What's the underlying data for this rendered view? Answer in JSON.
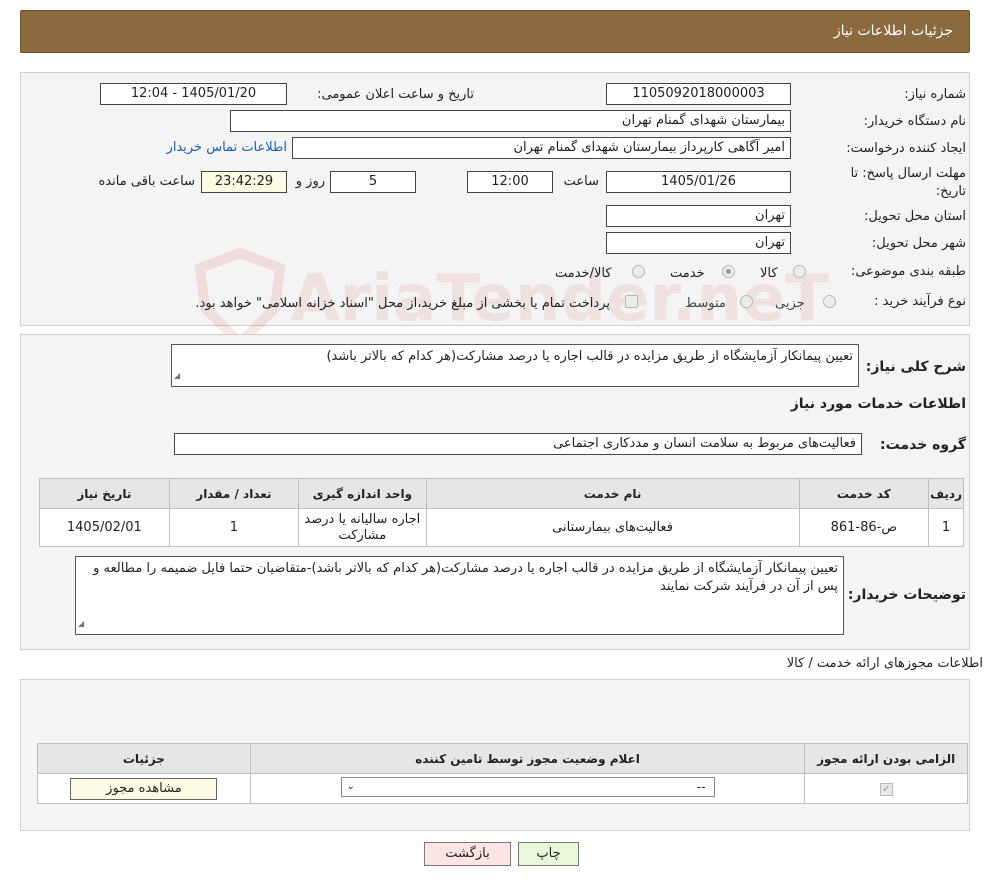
{
  "header": {
    "title": "جزئیات اطلاعات نیاز"
  },
  "form": {
    "need_number_label": "شماره نیاز:",
    "need_number": "1105092018000003",
    "announce_label": "تاریخ و ساعت اعلان عمومی:",
    "announce_value": "1405/01/20 - 12:04",
    "buyer_org_label": "نام دستگاه خریدار:",
    "buyer_org": "بیمارستان شهدای گمنام تهران",
    "creator_label": "ایجاد کننده درخواست:",
    "creator": "امیر آگاهی کارپرداز بیمارستان شهدای گمنام تهران",
    "contact_link": "اطلاعات تماس خریدار",
    "deadline_label_1": "مهلت ارسال پاسخ: تا",
    "deadline_label_2": "تاریخ:",
    "deadline_date": "1405/01/26",
    "time_label": "ساعت",
    "deadline_time": "12:00",
    "days_value": "5",
    "days_label": "روز و",
    "remaining_time": "23:42:29",
    "remaining_label": "ساعت باقی مانده",
    "province_label": "استان محل تحویل:",
    "province": "تهران",
    "city_label": "شهر محل تحویل:",
    "city": "تهران",
    "category_label": "طبقه بندی موضوعی:",
    "category_options": [
      "کالا",
      "خدمت",
      "کالا/خدمت"
    ],
    "category_selected": "خدمت",
    "process_label": "نوع فرآیند خرید :",
    "process_options": [
      "جزیی",
      "متوسط"
    ],
    "process_note": "پرداخت تمام یا بخشی از مبلغ خرید،از محل \"اسناد خزانه اسلامی\" خواهد بود."
  },
  "description": {
    "label": "شرح کلی نیاز:",
    "value": "تعیین پیمانکار آزمایشگاه از طریق مزایده در قالب اجاره یا درصد مشارکت(هر کدام که بالاتر باشد)"
  },
  "services": {
    "section_title": "اطلاعات خدمات مورد نیاز",
    "group_label": "گروه خدمت:",
    "group_value": "فعالیت‌های مربوط به سلامت انسان و مددکاری اجتماعی",
    "table": {
      "headers": [
        "ردیف",
        "کد خدمت",
        "نام خدمت",
        "واحد اندازه گیری",
        "تعداد / مقدار",
        "تاریخ نیاز"
      ],
      "rows": [
        [
          "1",
          "ص-86-861",
          "فعالیت‌های بیمارستانی",
          "اجاره سالیانه یا درصد مشارکت",
          "1",
          "1405/02/01"
        ]
      ]
    }
  },
  "buyer_notes": {
    "label": "توضیحات خریدار:",
    "value": "تعیین پیمانکار آزمایشگاه از طریق مزایده در قالب اجاره یا درصد مشارکت(هر کدام که بالاتر باشد)-متقاضیان حتما فایل ضمیمه را مطالعه و پس از آن در فرآیند شرکت نمایند"
  },
  "permits": {
    "section_title": "اطلاعات مجوزهای ارائه خدمت / کالا",
    "headers": [
      "الزامی بودن ارائه مجوز",
      "اعلام وضعیت مجوز توسط تامین کننده",
      "جزئیات"
    ],
    "select_value": "--",
    "view_button": "مشاهده مجوز"
  },
  "footer": {
    "print_button": "چاپ",
    "back_button": "بازگشت"
  },
  "watermark": "AriaTender.neT",
  "colors": {
    "header_bg": "#8b6a3f",
    "print_bg": "#e8f8d8",
    "back_bg": "#fde4e4",
    "view_bg": "#fdfbe4"
  }
}
